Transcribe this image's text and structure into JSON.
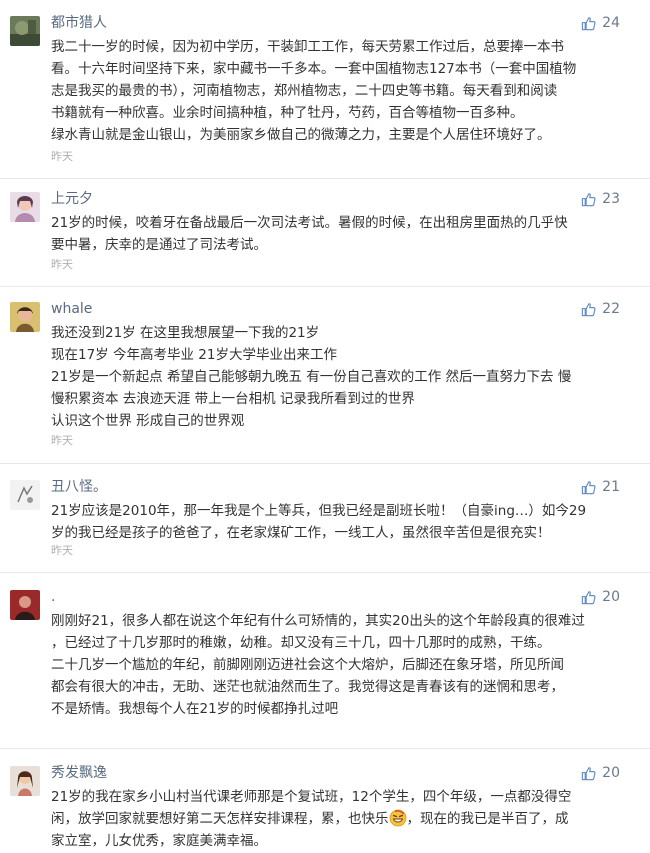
{
  "timestamp_label": "昨天",
  "accent_color": "#5a6a80",
  "comments": [
    {
      "username": "都市猎人",
      "likes": "24",
      "lines": [
        "我二十一岁的时候，因为初中学历，干装卸工工作，每天劳累工作过后，总要捧一本书",
        "看。十六年时间坚持下来，家中藏书一千多本。一套中国植物志127本书（一套中国植物",
        "志是我买的最贵的书），河南植物志，郑州植物志，二十四史等书籍。每天看到和阅读",
        "书籍就有一种欣喜。业余时间搞种植，种了牡丹，芍药，百合等植物一百多种。",
        "绿水青山就是金山银山，为美丽家乡做自己的微薄之力，主要是个人居住环境好了。"
      ],
      "time": "昨天"
    },
    {
      "username": "上元夕",
      "likes": "23",
      "lines": [
        "21岁的时候，咬着牙在备战最后一次司法考试。暑假的时候，在出租房里面热的几乎快",
        "要中暑，庆幸的是通过了司法考试。"
      ],
      "time": "昨天"
    },
    {
      "username": "whale",
      "likes": "22",
      "lines": [
        "我还没到21岁 在这里我想展望一下我的21岁",
        "现在17岁 今年高考毕业 21岁大学毕业出来工作",
        "21岁是一个新起点 希望自己能够朝九晚五 有一份自己喜欢的工作 然后一直努力下去 慢",
        "慢积累资本 去浪迹天涯 带上一台相机 记录我所看到过的世界",
        "认识这个世界 形成自己的世界观"
      ],
      "time": "昨天"
    },
    {
      "username": "丑八怪。",
      "likes": "21",
      "lines": [
        "21岁应该是2010年，那一年我是个上等兵，但我已经是副班长啦！（自豪ing…）如今29",
        "岁的我已经是孩子的爸爸了，在老家煤矿工作，一线工人，虽然很辛苦但是很充实！"
      ],
      "time": "昨天"
    },
    {
      "username": ".",
      "likes": "20",
      "lines": [
        "刚刚好21，很多人都在说这个年纪有什么可矫情的，其实20出头的这个年龄段真的很难过",
        "，已经过了十几岁那时的稚嫩，幼稚。却又没有三十几，四十几那时的成熟，干练。",
        "二十几岁一个尴尬的年纪，前脚刚刚迈进社会这个大熔炉，后脚还在象牙塔，所见所闻",
        "都会有很大的冲击，无助、迷茫也就油然而生了。我觉得这是青春该有的迷惘和思考，",
        "不是矫情。我想每个人在21岁的时候都挣扎过吧"
      ],
      "time": ""
    },
    {
      "username": "秀发飘逸",
      "likes": "20",
      "lines": [
        "21岁的我在家乡小山村当代课老师那是个复试班，12个学生，四个年级，一点都没得空",
        "闲，放学回家就要想好第二天怎样安排课程，累，也快乐",
        "家立室，儿女优秀，家庭美满幸福。"
      ],
      "line2_after_emoji": "，现在的我已是半百了，成",
      "emoji_icon": "grinning-face-emoji",
      "time": ""
    }
  ]
}
